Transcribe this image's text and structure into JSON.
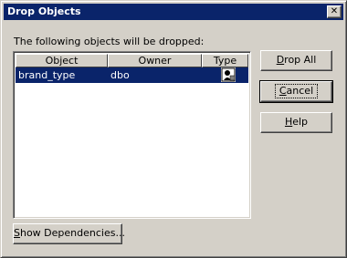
{
  "window": {
    "title": "Drop Objects",
    "close_label": "✕"
  },
  "caption": "The following objects will be dropped:",
  "table": {
    "columns": [
      "Object",
      "Owner",
      "Type"
    ],
    "rows": [
      {
        "object": "brand_type",
        "owner": "dbo",
        "type_icon": "user-defined-type-icon"
      }
    ]
  },
  "buttons": {
    "drop_all": {
      "pre": "",
      "mnemonic": "D",
      "post": "rop All"
    },
    "cancel": {
      "pre": "",
      "mnemonic": "C",
      "post": "ancel"
    },
    "help": {
      "pre": "",
      "mnemonic": "H",
      "post": "elp"
    },
    "show_dependencies": {
      "pre": "",
      "mnemonic": "S",
      "post": "how Dependencies..."
    }
  },
  "colors": {
    "title_bar": "#0a246a",
    "selection": "#0a246a",
    "face": "#d4d0c8"
  }
}
